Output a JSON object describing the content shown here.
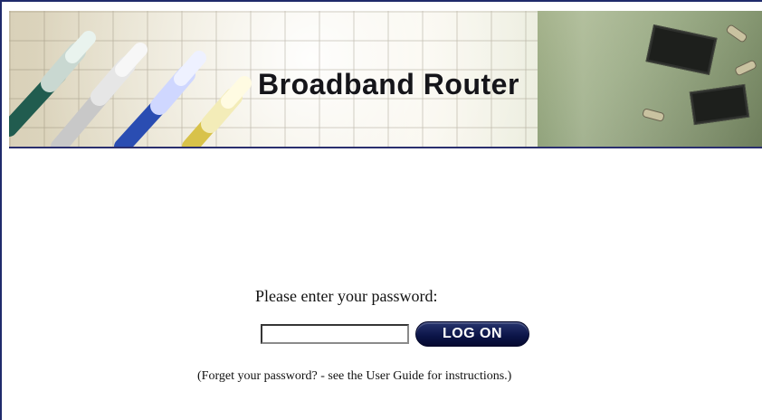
{
  "header": {
    "title": "Broadband Router"
  },
  "login": {
    "prompt": "Please enter your password:",
    "password_value": "",
    "password_placeholder": "",
    "logon_label": "LOG ON",
    "help_text": "(Forget your password? - see the User Guide for instructions.)"
  },
  "colors": {
    "accent": "#0b1447",
    "border": "#1f2a6b"
  },
  "icons": {
    "cables": "ethernet-cables-icon",
    "circuit_board": "circuit-board-icon"
  }
}
